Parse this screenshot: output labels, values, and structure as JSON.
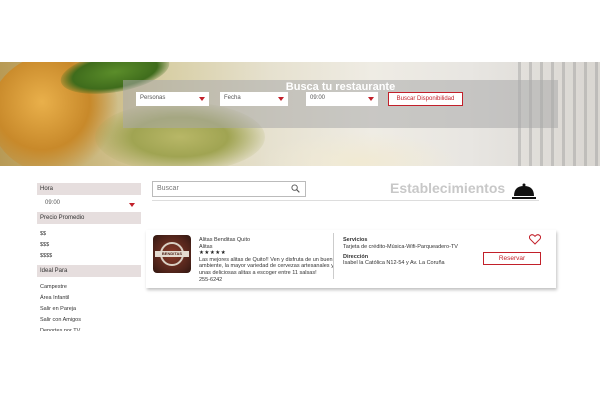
{
  "hero": {
    "title": "Busca tu restaurante",
    "personas_placeholder": "Personas",
    "fecha_placeholder": "Fecha",
    "hora_value": "09:00",
    "search_button": "Buscar Disponibilidad"
  },
  "sidebar": {
    "hora_header": "Hora",
    "hora_value": "09:00",
    "precio_header": "Precio Promedio",
    "precio_items": [
      "$$",
      "$$$",
      "$$$$"
    ],
    "ideal_header": "Ideal Para",
    "ideal_items": [
      "Campestre",
      "Área Infantil",
      "Salir en Pareja",
      "Salir con Amigos",
      "Deportes por TV"
    ]
  },
  "main": {
    "search_placeholder": "Buscar",
    "section_title": "Establecimientos"
  },
  "restaurant": {
    "logo_text": "BENDITAS",
    "name": "Alitas Benditas Quito",
    "category": "Alitas",
    "stars": "★★★★★",
    "description": "Las mejores alitas de Quito!! Ven y disfruta de un buen ambiente, la mayor variedad de cervezas artesanales y unas deliciosas alitas a escoger entre 11 salsas!",
    "phone": "255-6242",
    "services_label": "Servicios",
    "services_value": "Tarjeta de crédito-Música-Wifi-Parqueadero-TV",
    "address_label": "Dirección",
    "address_value": "Isabel la Católica N12-54 y Av. La Coruña",
    "reserve_button": "Reservar"
  },
  "colors": {
    "accent": "#c2202a",
    "sidebar_header_bg": "#e6dede"
  }
}
